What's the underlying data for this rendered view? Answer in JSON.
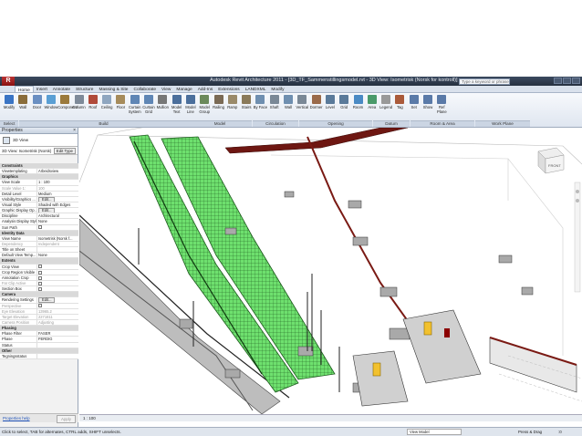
{
  "app": {
    "title": "Autodesk Revit Architecture 2011 - [3D_TF_Sammenstillingsmodel.rvt - 3D View: Isometrisk (Norsk for kontroll)]",
    "app_letter": "R",
    "search_placeholder": "Type a keyword or phrase"
  },
  "tabs": [
    "Home",
    "Insert",
    "Annotate",
    "Structure",
    "Massing & Site",
    "Collaborate",
    "View",
    "Manage",
    "Add-Ins",
    "Extensions",
    "LANDXML",
    "Modify"
  ],
  "ribbon": {
    "buttons": [
      "Modify",
      "Wall",
      "Door",
      "Window",
      "Component",
      "Column",
      "Roof",
      "Ceiling",
      "Floor",
      "Curtain System",
      "Curtain Grid",
      "Mullion",
      "Model Text",
      "Model Line",
      "Model Group",
      "Railing",
      "Ramp",
      "Stairs",
      "By Face",
      "Shaft",
      "Wall",
      "Vertical",
      "Dormer",
      "Level",
      "Grid",
      "Room",
      "Area",
      "Legend",
      "Tag",
      "Set",
      "Show",
      "Ref Plane"
    ],
    "panels": [
      "Select",
      "Build",
      "Model",
      "Circulation",
      "Opening",
      "Datum",
      "Room & Area",
      "Work Plane"
    ]
  },
  "properties": {
    "header": "Properties",
    "close": "×",
    "type_selector": "3D View",
    "type_dropdown": "3D View: Isometrisk (Norsk)",
    "edit_type": "Edit Type",
    "rows": [
      {
        "cat": "Constraints"
      },
      {
        "k": "Viewtemplating",
        "v": "Arbeidsview"
      },
      {
        "cat": "Graphics"
      },
      {
        "k": "View Scale",
        "v": "1 : 100"
      },
      {
        "k": "Scale Value 1:",
        "v": "100",
        "gray": true
      },
      {
        "k": "Detail Level",
        "v": "Medium"
      },
      {
        "k": "Visibility/Graphics ...",
        "btn": "Edit..."
      },
      {
        "k": "Visual Style",
        "v": "Shaded with Edges"
      },
      {
        "k": "Graphic Display Op...",
        "btn": "Edit..."
      },
      {
        "k": "Discipline",
        "v": "Architectural"
      },
      {
        "k": "Analysis Display Style",
        "v": "None"
      },
      {
        "k": "Sun Path",
        "cb": true
      },
      {
        "cat": "Identity Data"
      },
      {
        "k": "View Name",
        "v": "Isometrisk (Norsk f..."
      },
      {
        "k": "Dependency",
        "v": "Independent",
        "gray": true
      },
      {
        "k": "Title on Sheet",
        "v": ""
      },
      {
        "k": "Default View Temp...",
        "v": "None"
      },
      {
        "cat": "Extents"
      },
      {
        "k": "Crop View",
        "cb": true
      },
      {
        "k": "Crop Region Visible",
        "cb": true
      },
      {
        "k": "Annotation Crop",
        "cb": true
      },
      {
        "k": "Far Clip Active",
        "cb": true,
        "gray": true
      },
      {
        "k": "Section Box",
        "cb": true
      },
      {
        "cat": "Camera"
      },
      {
        "k": "Rendering Settings",
        "btn": "Edit..."
      },
      {
        "k": "Perspective",
        "cb": true,
        "gray": true
      },
      {
        "k": "Eye Elevation",
        "v": "13965.2",
        "gray": true
      },
      {
        "k": "Target Elevation",
        "v": "2271811",
        "gray": true
      },
      {
        "k": "Camera Position",
        "v": "Adjusting",
        "gray": true
      },
      {
        "cat": "Phasing"
      },
      {
        "k": "Phase Filter",
        "v": "FASER"
      },
      {
        "k": "Phase",
        "v": "FERDIG"
      },
      {
        "k": "Status",
        "v": ""
      },
      {
        "cat": "Other"
      },
      {
        "k": "Tegningsstatus",
        "v": ""
      }
    ],
    "help_link": "Properties help",
    "apply": "Apply"
  },
  "view": {
    "scale_label": "1 : 100",
    "viewcube_label": "FRONT",
    "colors": {
      "green": "#5fe05f",
      "darkred": "#7a1a14",
      "gold": "#f2c12e"
    }
  },
  "status": {
    "hint": "Click to select, TAB for alternates, CTRL adds, SHIFT unselects.",
    "workset": "View Model",
    "press_drag": "Press & Drag",
    "filter": ":0"
  }
}
